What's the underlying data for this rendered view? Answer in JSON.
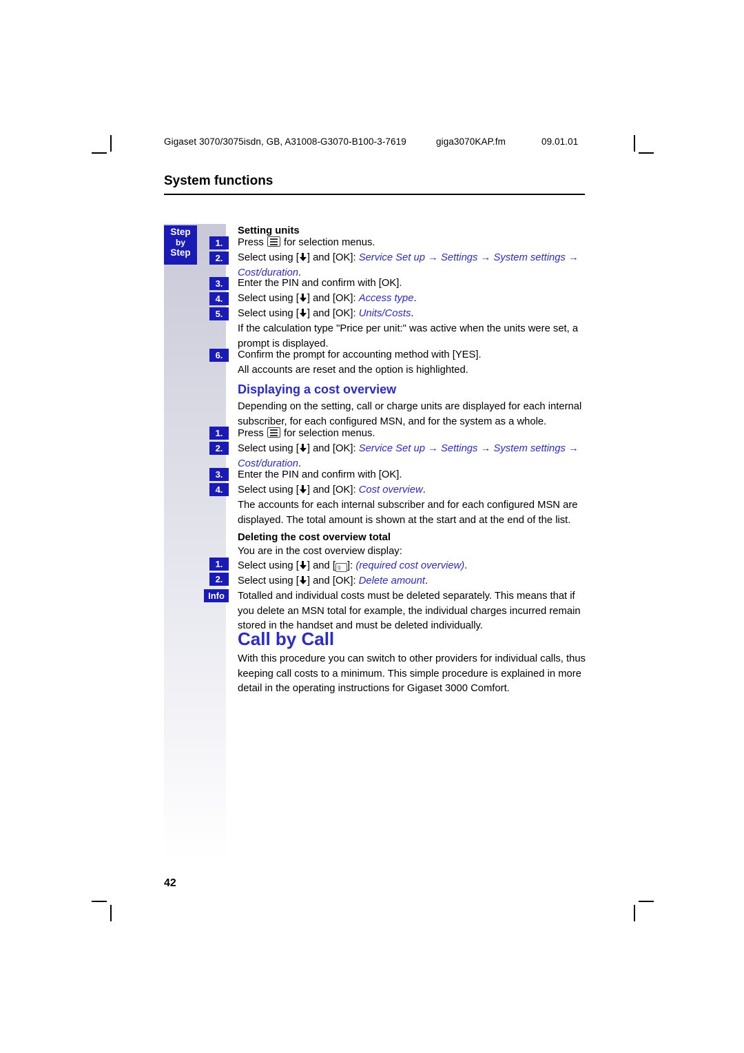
{
  "header": {
    "document_ref": "Gigaset 3070/3075isdn, GB, A31008-G3070-B100-3-7619",
    "file_name": "giga3070KAP.fm",
    "date": "09.01.01"
  },
  "chapter": {
    "title": "System functions"
  },
  "sidebar": {
    "step_badge": {
      "line1": "Step",
      "line2": "by",
      "line3": "Step"
    },
    "info_badge": "Info",
    "chips_setting_units": [
      "1.",
      "2.",
      "3.",
      "4.",
      "5.",
      "6."
    ],
    "chips_cost_overview": [
      "1.",
      "2.",
      "3.",
      "4."
    ],
    "chips_deleting": [
      "1.",
      "2."
    ]
  },
  "sections": {
    "setting_units": {
      "heading": "Setting units",
      "step1_pre": "Press ",
      "step1_post": " for selection menus.",
      "step2_pre": "Select using [",
      "step2_mid": "] and [OK]: ",
      "step2_path1": "Service Set up",
      "step2_path2": "Settings",
      "step2_path3": "System settings",
      "step2_path4": "Cost/duration",
      "step2_end": ".",
      "step3": "Enter the PIN and confirm with [OK].",
      "step4_pre": "Select using [",
      "step4_mid": "] and [OK]: ",
      "step4_item": "Access type",
      "step4_end": ".",
      "step5_pre": "Select using [",
      "step5_mid": "] and [OK]: ",
      "step5_item": "Units/Costs",
      "step5_end": ".",
      "note": "If the calculation type \"Price per unit:\" was active when the units were set, a prompt is displayed.",
      "step6": "Confirm the prompt for accounting method with [YES].",
      "closing": "All accounts are reset and the option is highlighted."
    },
    "cost_overview": {
      "heading": "Displaying a cost overview",
      "intro": "Depending on the setting, call or charge units are displayed for each internal subscriber, for each configured MSN, and for the system as a whole.",
      "step1_pre": "Press ",
      "step1_post": " for selection menus.",
      "step2_pre": "Select using [",
      "step2_mid": "] and [OK]: ",
      "step2_path1": "Service Set up",
      "step2_path2": "Settings",
      "step2_path3": "System settings",
      "step2_path4": "Cost/duration",
      "step2_end": ".",
      "step3": "Enter the PIN and confirm with [OK].",
      "step4_pre": "Select using [",
      "step4_mid": "] and [OK]: ",
      "step4_item": "Cost overview",
      "step4_end": ".",
      "closing": "The accounts for each internal subscriber and for each configured MSN are displayed. The total amount is shown at the start and at the end of the list."
    },
    "deleting": {
      "heading": "Deleting the cost overview total",
      "intro": "You are in the cost overview display:",
      "step1_pre": "Select using [",
      "step1_mid": "] and [",
      "step1_key": "9",
      "step1_post": "]: ",
      "step1_italic": "(required cost overview)",
      "step1_end": ".",
      "step2_pre": "Select using [",
      "step2_mid": "] and [OK]: ",
      "step2_item": "Delete amount",
      "step2_end": ".",
      "info_text": "Totalled and individual costs must be deleted separately. This means that if you delete an MSN total for example, the individual charges incurred remain stored in the handset and must be deleted individually."
    },
    "call_by_call": {
      "heading": "Call by Call",
      "body": "With this procedure you can switch to other providers for individual calls, thus keeping call costs to a minimum. This simple procedure is explained in more detail in the operating instructions for Gigaset 3000 Comfort."
    }
  },
  "footer": {
    "page_number": "42"
  },
  "colors": {
    "accent_blue": "#2b2bc8",
    "badge_blue": "#1a1ab4"
  }
}
